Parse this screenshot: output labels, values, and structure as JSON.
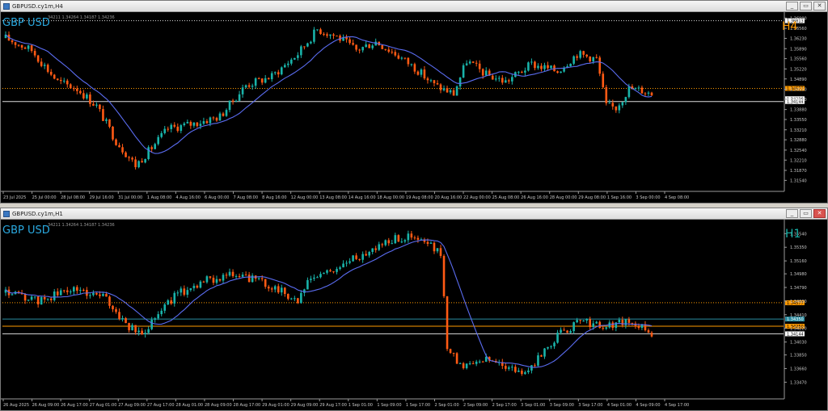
{
  "windows": [
    {
      "id": "h4",
      "title": "GBPUSD.cy1m,H4",
      "symbol_label": "GBP USD",
      "ohlc_text": "34211 1.34264 1.34187 1.34236",
      "timeframe_label": "H4",
      "timeframe_color": "#ff9a00",
      "price_min": 1.3123,
      "price_max": 1.3699,
      "price_ticks": [
        "1.36900",
        "1.36560",
        "1.36230",
        "1.35890",
        "1.35560",
        "1.35220",
        "1.34890",
        "1.34550",
        "1.34220",
        "1.33880",
        "1.33550",
        "1.33210",
        "1.32880",
        "1.32540",
        "1.32210",
        "1.31870",
        "1.31540"
      ],
      "price_tags": [
        {
          "label": "1.36813",
          "value": 1.36813,
          "color": "#ffffff",
          "text_color": "#000000",
          "line": "dotted-white"
        },
        {
          "label": "1.34577",
          "value": 1.34577,
          "color": "#ff9a00",
          "text_color": "#000000",
          "line": "dotted-orange"
        },
        {
          "label": "1.34236",
          "value": 1.34236,
          "color": "#ffffff",
          "text_color": "#000000",
          "line": "none"
        },
        {
          "label": "1.34144",
          "value": 1.34144,
          "color": "#ffffff",
          "text_color": "#000000",
          "line": "solid-white"
        }
      ],
      "time_labels": [
        "23 Jul 2025",
        "25 Jul 00:00",
        "28 Jul 08:00",
        "29 Jul 16:00",
        "31 Jul 00:00",
        "1 Aug 08:00",
        "4 Aug 16:00",
        "6 Aug 00:00",
        "7 Aug 08:00",
        "8 Aug 16:00",
        "12 Aug 00:00",
        "13 Aug 08:00",
        "14 Aug 16:00",
        "18 Aug 00:00",
        "19 Aug 08:00",
        "20 Aug 16:00",
        "22 Aug 00:00",
        "25 Aug 08:00",
        "26 Aug 16:00",
        "28 Aug 00:00",
        "29 Aug 08:00",
        "1 Sep 16:00",
        "3 Sep 00:00",
        "4 Sep 08:00"
      ],
      "candle_count": 200,
      "last_price": 1.34236,
      "ma_color": "#5a6cf0"
    },
    {
      "id": "h1",
      "title": "GBPUSD.cy1m,H1",
      "symbol_label": "GBP USD",
      "ohlc_text": "34211 1.34264 1.34187 1.34236",
      "timeframe_label": "H1",
      "timeframe_color": "#19b3a9",
      "price_min": 1.3326,
      "price_max": 1.3569,
      "price_ticks": [
        "1.35540",
        "1.35350",
        "1.35160",
        "1.34980",
        "1.34790",
        "1.34600",
        "1.34410",
        "1.34220",
        "1.34030",
        "1.33850",
        "1.33660",
        "1.33470"
      ],
      "price_tags": [
        {
          "label": "1.34577",
          "value": 1.34577,
          "color": "#ff9a00",
          "text_color": "#000000",
          "line": "dotted-orange"
        },
        {
          "label": "1.34350",
          "value": 1.3435,
          "color": "#2a8ca0",
          "text_color": "#ffffff",
          "line": "solid-teal"
        },
        {
          "label": "1.34250",
          "value": 1.3425,
          "color": "#ff9a00",
          "text_color": "#000000",
          "line": "solid-orange"
        },
        {
          "label": "1.34144",
          "value": 1.34144,
          "color": "#ffffff",
          "text_color": "#000000",
          "line": "solid-white"
        }
      ],
      "time_labels": [
        "26 Aug 2025",
        "26 Aug 09:00",
        "26 Aug 17:00",
        "27 Aug 01:00",
        "27 Aug 09:00",
        "27 Aug 17:00",
        "28 Aug 01:00",
        "28 Aug 09:00",
        "28 Aug 17:00",
        "29 Aug 01:00",
        "29 Aug 09:00",
        "29 Aug 17:00",
        "1 Sep 01:00",
        "1 Sep 09:00",
        "1 Sep 17:00",
        "2 Sep 01:00",
        "2 Sep 09:00",
        "2 Sep 17:00",
        "3 Sep 01:00",
        "3 Sep 09:00",
        "3 Sep 17:00",
        "4 Sep 01:00",
        "4 Sep 09:00",
        "4 Sep 17:00"
      ],
      "candle_count": 200,
      "last_price": 1.34236,
      "ma_color": "#5a6cf0"
    }
  ],
  "colors": {
    "bull": "#19b3a9",
    "bear": "#ff5a14",
    "axis_text": "#c8c8c8",
    "symbol_text": "#2aa9e0"
  },
  "window_buttons": [
    "_",
    "▭",
    "✕"
  ]
}
